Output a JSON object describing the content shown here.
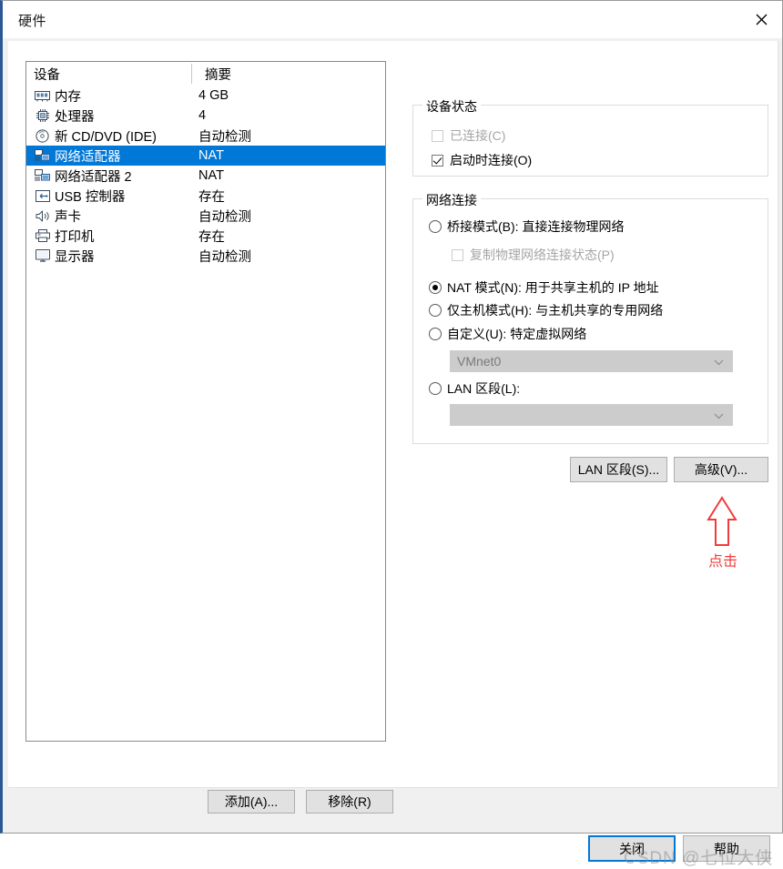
{
  "window": {
    "title": "硬件",
    "close_icon": "close-icon"
  },
  "device_list": {
    "columns": {
      "device": "设备",
      "summary": "摘要"
    },
    "rows": [
      {
        "icon": "memory-icon",
        "label": "内存",
        "summary": "4 GB",
        "selected": false
      },
      {
        "icon": "cpu-icon",
        "label": "处理器",
        "summary": "4",
        "selected": false
      },
      {
        "icon": "disc-icon",
        "label": "新 CD/DVD (IDE)",
        "summary": "自动检测",
        "selected": false
      },
      {
        "icon": "network-icon",
        "label": "网络适配器",
        "summary": "NAT",
        "selected": true
      },
      {
        "icon": "network-icon",
        "label": "网络适配器 2",
        "summary": "NAT",
        "selected": false
      },
      {
        "icon": "usb-icon",
        "label": "USB 控制器",
        "summary": "存在",
        "selected": false
      },
      {
        "icon": "sound-icon",
        "label": "声卡",
        "summary": "自动检测",
        "selected": false
      },
      {
        "icon": "printer-icon",
        "label": "打印机",
        "summary": "存在",
        "selected": false
      },
      {
        "icon": "display-icon",
        "label": "显示器",
        "summary": "自动检测",
        "selected": false
      }
    ],
    "add_label": "添加(A)...",
    "remove_label": "移除(R)"
  },
  "device_status": {
    "title": "设备状态",
    "connected": {
      "label": "已连接(C)",
      "checked": false,
      "disabled": true
    },
    "connect_at_power_on": {
      "label": "启动时连接(O)",
      "checked": true,
      "disabled": false
    }
  },
  "network_connection": {
    "title": "网络连接",
    "bridged": {
      "label": "桥接模式(B): 直接连接物理网络",
      "selected": false
    },
    "replicate": {
      "label": "复制物理网络连接状态(P)",
      "checked": false,
      "disabled": true
    },
    "nat": {
      "label": "NAT 模式(N): 用于共享主机的 IP 地址",
      "selected": true
    },
    "host_only": {
      "label": "仅主机模式(H): 与主机共享的专用网络",
      "selected": false
    },
    "custom": {
      "label": "自定义(U): 特定虚拟网络",
      "selected": false
    },
    "custom_combo": {
      "value": "VMnet0",
      "disabled": true
    },
    "lan_segment": {
      "label": "LAN 区段(L):",
      "selected": false
    },
    "lan_combo": {
      "value": "",
      "disabled": true
    },
    "lan_segment_button": "LAN 区段(S)...",
    "advanced_button": "高级(V)..."
  },
  "annotation": {
    "text": "点击",
    "color": "#f03c3c",
    "icon": "up-arrow-icon"
  },
  "footer": {
    "close_label": "关闭",
    "help_label": "帮助"
  },
  "watermark": {
    "text": "CSDN @七位大侠"
  },
  "colors": {
    "selection_blue": "#0078d7",
    "accent_stripe": "#2b5797",
    "annotation_red": "#f03c3c",
    "button_face": "#e1e1e1",
    "disabled_combo": "#cccccc"
  }
}
